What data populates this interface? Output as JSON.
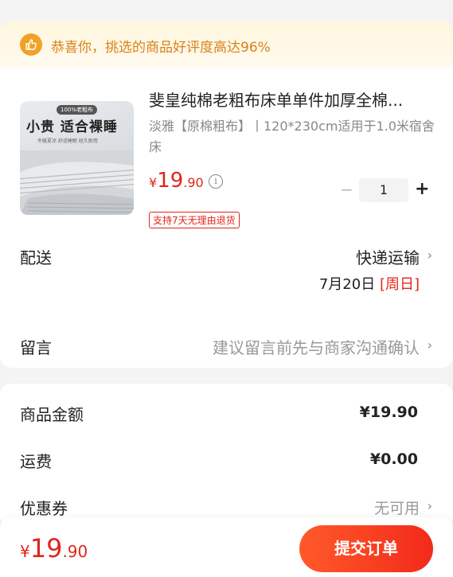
{
  "banner": {
    "text": "恭喜你，挑选的商品好评度高达96%",
    "icon": "thumbs-up-icon"
  },
  "product": {
    "thumb_badge": "100%老粗布",
    "thumb_title": "小贵  适合裸睡",
    "thumb_sub": "冬暖夏凉 舒适睡眠 经久耐用",
    "title": "斐皇纯棉老粗布床单单件加厚全棉...",
    "spec": "淡雅【原棉粗布】丨120*230cm适用于1.0米宿舍床",
    "price_currency": "¥",
    "price_int": "19",
    "price_dec": ".90",
    "quantity": "1",
    "minus": "−",
    "plus": "+",
    "return_tag": "支持7天无理由退货"
  },
  "delivery": {
    "label": "配送",
    "value": "快递运输",
    "date": "7月20日",
    "weekday": "[周日]"
  },
  "message": {
    "label": "留言",
    "placeholder": "建议留言前先与商家沟通确认"
  },
  "summary": {
    "goods_label": "商品金额",
    "goods_value": "¥19.90",
    "shipping_label": "运费",
    "shipping_value": "¥0.00",
    "coupon_label": "优惠券",
    "coupon_value": "无可用"
  },
  "footer": {
    "currency": "¥",
    "total_int": "19",
    "total_dec": ".90",
    "submit_label": "提交订单"
  },
  "colors": {
    "accent": "#e1251b",
    "banner_text": "#d9821c",
    "submit_start": "#ff5a2a",
    "submit_end": "#f22a1a"
  }
}
